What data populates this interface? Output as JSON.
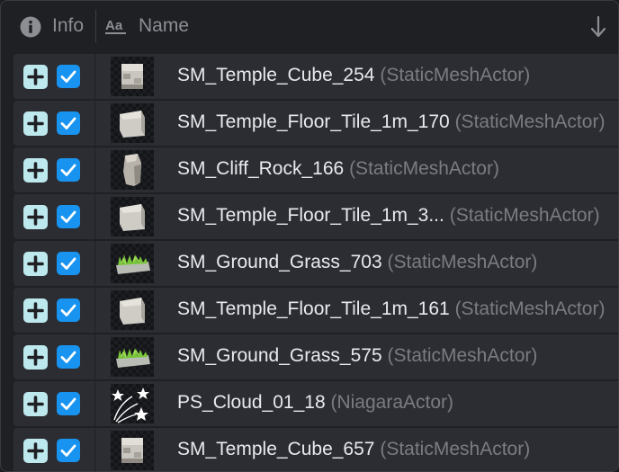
{
  "header": {
    "info_label": "Info",
    "name_label": "Name",
    "info_icon": "info-icon",
    "type_icon": "text-aa-icon",
    "sort_icon": "sort-arrow-down-icon"
  },
  "colors": {
    "checkbox": "#1894f0",
    "add_icon": "#bde9ee",
    "row_bg": "#2c2d32",
    "panel_bg": "#1f2024"
  },
  "rows": [
    {
      "name": "SM_Temple_Cube_254",
      "type": "(StaticMeshActor)",
      "checked": true,
      "thumb": "temple-cube-thumbnail"
    },
    {
      "name": "SM_Temple_Floor_Tile_1m_170",
      "type": "(StaticMeshActor)",
      "checked": true,
      "thumb": "floor-tile-thumbnail"
    },
    {
      "name": "SM_Cliff_Rock_166",
      "type": "(StaticMeshActor)",
      "checked": true,
      "thumb": "cliff-rock-thumbnail"
    },
    {
      "name": "SM_Temple_Floor_Tile_1m_3...",
      "type": "(StaticMeshActor)",
      "checked": true,
      "thumb": "floor-tile-thumbnail"
    },
    {
      "name": "SM_Ground_Grass_703",
      "type": "(StaticMeshActor)",
      "checked": true,
      "thumb": "ground-grass-thumbnail"
    },
    {
      "name": "SM_Temple_Floor_Tile_1m_161",
      "type": "(StaticMeshActor)",
      "checked": true,
      "thumb": "floor-tile-thumbnail"
    },
    {
      "name": "SM_Ground_Grass_575",
      "type": "(StaticMeshActor)",
      "checked": true,
      "thumb": "ground-grass-thumbnail"
    },
    {
      "name": "PS_Cloud_01_18",
      "type": "(NiagaraActor)",
      "checked": true,
      "thumb": "niagara-particle-icon"
    },
    {
      "name": "SM_Temple_Cube_657",
      "type": "(StaticMeshActor)",
      "checked": true,
      "thumb": "temple-cube-thumbnail"
    }
  ]
}
